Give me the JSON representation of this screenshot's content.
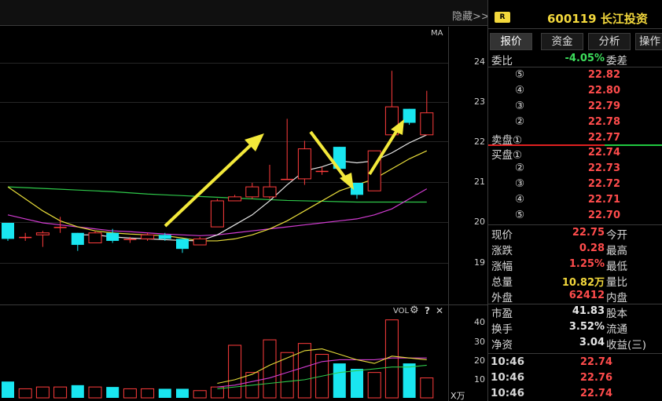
{
  "top_bar": {
    "hide_label": "隐藏>>"
  },
  "chart": {
    "ma_label": "MA",
    "price_ticks": [
      "24",
      "23",
      "22",
      "21",
      "20",
      "19"
    ],
    "vol_label": "VOL",
    "vol_ticks": [
      "40",
      "30",
      "20",
      "10"
    ],
    "vol_unit": "X万",
    "help_glyph": "?",
    "close_glyph": "✕",
    "gear_glyph": "⚙"
  },
  "quote": {
    "badge": "R",
    "code_name": "600119 长江投资",
    "tabs": [
      "报价",
      "资金",
      "分析",
      "操作"
    ],
    "weibi_label": "委比",
    "weibi_value": "-4.05%",
    "weicha_label": "委差",
    "sell_levels": [
      {
        "label": "⑤",
        "price": "22.82"
      },
      {
        "label": "④",
        "price": "22.80"
      },
      {
        "label": "③",
        "price": "22.79"
      },
      {
        "label": "②",
        "price": "22.78"
      },
      {
        "label": "卖盘①",
        "price": "22.77"
      }
    ],
    "buy_levels": [
      {
        "label": "买盘①",
        "price": "22.74"
      },
      {
        "label": "②",
        "price": "22.73"
      },
      {
        "label": "③",
        "price": "22.72"
      },
      {
        "label": "④",
        "price": "22.71"
      },
      {
        "label": "⑤",
        "price": "22.70"
      }
    ],
    "stats": [
      {
        "label": "现价",
        "value": "22.75",
        "label2": "今开"
      },
      {
        "label": "涨跌",
        "value": "0.28",
        "label2": "最高"
      },
      {
        "label": "涨幅",
        "value": "1.25%",
        "label2": "最低"
      },
      {
        "label": "总量",
        "value": "10.82万",
        "label2": "量比"
      },
      {
        "label": "外盘",
        "value": "62412",
        "label2": "内盘"
      }
    ],
    "stats2": [
      {
        "label": "市盈",
        "value": "41.83",
        "label2": "股本"
      },
      {
        "label": "换手",
        "value": "3.52%",
        "label2": "流通"
      },
      {
        "label": "净资",
        "value": "3.04",
        "label2": "收益(三)"
      }
    ],
    "ticks": [
      {
        "time": "10:46",
        "price": "22.74"
      },
      {
        "time": "10:46",
        "price": "22.76"
      },
      {
        "time": "10:46",
        "price": "22.74"
      }
    ]
  },
  "chart_data": {
    "type": "candlestick",
    "ylim": [
      18.9,
      24.4
    ],
    "candles": [
      {
        "o": 20.0,
        "c": 19.6,
        "h": 20.0,
        "l": 19.55
      },
      {
        "o": 19.65,
        "c": 19.65,
        "h": 19.75,
        "l": 19.55
      },
      {
        "o": 19.7,
        "c": 19.75,
        "h": 19.8,
        "l": 19.4
      },
      {
        "o": 19.9,
        "c": 19.9,
        "h": 20.15,
        "l": 19.75
      },
      {
        "o": 19.75,
        "c": 19.45,
        "h": 19.75,
        "l": 19.3
      },
      {
        "o": 19.5,
        "c": 19.75,
        "h": 19.8,
        "l": 19.5
      },
      {
        "o": 19.75,
        "c": 19.55,
        "h": 19.85,
        "l": 19.5
      },
      {
        "o": 19.6,
        "c": 19.6,
        "h": 19.65,
        "l": 19.5
      },
      {
        "o": 19.6,
        "c": 19.7,
        "h": 19.75,
        "l": 19.55
      },
      {
        "o": 19.7,
        "c": 19.6,
        "h": 19.75,
        "l": 19.55
      },
      {
        "o": 19.6,
        "c": 19.35,
        "h": 19.6,
        "l": 19.25
      },
      {
        "o": 19.45,
        "c": 19.6,
        "h": 19.65,
        "l": 19.45
      },
      {
        "o": 19.9,
        "c": 20.55,
        "h": 20.6,
        "l": 19.9
      },
      {
        "o": 20.55,
        "c": 20.65,
        "h": 20.7,
        "l": 20.55
      },
      {
        "o": 20.65,
        "c": 20.9,
        "h": 21.0,
        "l": 20.6
      },
      {
        "o": 20.65,
        "c": 20.9,
        "h": 21.45,
        "l": 20.6
      },
      {
        "o": 21.1,
        "c": 21.1,
        "h": 22.6,
        "l": 21.1
      },
      {
        "o": 21.1,
        "c": 21.85,
        "h": 22.05,
        "l": 20.95
      },
      {
        "o": 21.3,
        "c": 21.3,
        "h": 21.4,
        "l": 21.2
      },
      {
        "o": 21.9,
        "c": 21.35,
        "h": 21.9,
        "l": 21.35
      },
      {
        "o": 21.0,
        "c": 20.7,
        "h": 21.0,
        "l": 20.6
      },
      {
        "o": 20.8,
        "c": 21.8,
        "h": 21.8,
        "l": 20.8
      },
      {
        "o": 22.2,
        "c": 22.9,
        "h": 23.8,
        "l": 22.2
      },
      {
        "o": 22.85,
        "c": 22.5,
        "h": 22.85,
        "l": 22.45
      },
      {
        "o": 22.2,
        "c": 22.75,
        "h": 23.3,
        "l": 22.2
      }
    ],
    "ma_white": [
      null,
      null,
      null,
      null,
      19.7,
      19.7,
      19.65,
      19.62,
      19.6,
      19.58,
      19.56,
      19.55,
      19.7,
      19.95,
      20.2,
      20.55,
      20.95,
      21.3,
      21.4,
      21.55,
      21.5,
      21.55,
      21.75,
      22.0,
      22.2
    ],
    "ma_yellow": [
      20.9,
      20.6,
      20.3,
      20.05,
      19.9,
      19.8,
      19.75,
      19.72,
      19.7,
      19.68,
      19.62,
      19.55,
      19.55,
      19.6,
      19.7,
      19.85,
      20.05,
      20.3,
      20.55,
      20.8,
      20.95,
      21.1,
      21.35,
      21.6,
      21.8
    ],
    "ma_magenta": [
      20.2,
      20.1,
      20.0,
      19.95,
      19.9,
      19.85,
      19.8,
      19.78,
      19.75,
      19.72,
      19.7,
      19.68,
      19.7,
      19.75,
      19.8,
      19.85,
      19.9,
      19.95,
      20.0,
      20.05,
      20.1,
      20.2,
      20.35,
      20.6,
      20.85
    ],
    "ma_green": [
      20.9,
      20.88,
      20.86,
      20.84,
      20.82,
      20.8,
      20.78,
      20.75,
      20.72,
      20.7,
      20.68,
      20.66,
      20.64,
      20.62,
      20.6,
      20.58,
      20.56,
      20.55,
      20.54,
      20.53,
      20.52,
      20.52,
      20.52,
      20.52,
      20.52
    ],
    "volumes": [
      9,
      5,
      6,
      6,
      7,
      6,
      6,
      5,
      5,
      5,
      5,
      4,
      6,
      29,
      14,
      32,
      25,
      30,
      24,
      19,
      16,
      14,
      43,
      19,
      11
    ],
    "vol_ylim": [
      0,
      45
    ],
    "vol_ma_yellow": [
      null,
      null,
      null,
      null,
      null,
      null,
      null,
      null,
      null,
      null,
      null,
      null,
      8,
      10,
      13,
      18,
      22,
      26,
      27,
      24,
      21,
      19,
      23,
      22,
      21
    ],
    "vol_ma_magenta": [
      null,
      null,
      null,
      null,
      null,
      null,
      null,
      null,
      null,
      null,
      null,
      null,
      6,
      7,
      9,
      11,
      14,
      17,
      20,
      21,
      21,
      21,
      22,
      22,
      22
    ],
    "vol_ma_green": [
      null,
      null,
      null,
      null,
      null,
      null,
      null,
      null,
      null,
      null,
      null,
      null,
      5,
      6,
      7,
      8,
      9,
      10,
      12,
      14,
      15,
      16,
      17,
      17,
      18
    ]
  }
}
